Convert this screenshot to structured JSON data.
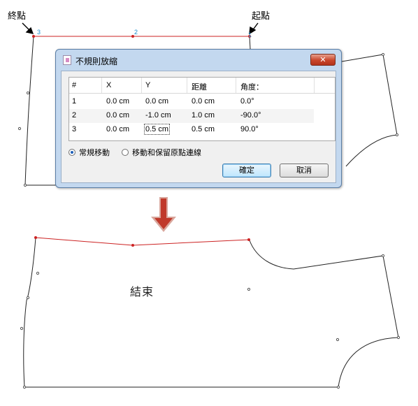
{
  "annotations": {
    "end_point": "終點",
    "start_point": "起點",
    "result": "結束"
  },
  "point_numbers": [
    "3",
    "2",
    "1"
  ],
  "dialog": {
    "title": "不規則放縮",
    "close_symbol": "✕",
    "columns": [
      "#",
      "X",
      "Y",
      "距離",
      "角度："
    ],
    "rows": [
      {
        "num": "1",
        "x": "0.0 cm",
        "y": "0.0 cm",
        "dist": "0.0 cm",
        "angle": "0.0°"
      },
      {
        "num": "2",
        "x": "0.0 cm",
        "y": "-1.0 cm",
        "dist": "1.0 cm",
        "angle": "-90.0°"
      },
      {
        "num": "3",
        "x": "0.0 cm",
        "y": "0.5 cm",
        "dist": "0.5 cm",
        "angle": "90.0°"
      }
    ],
    "options": [
      {
        "label": "常規移動",
        "selected": true
      },
      {
        "label": "移動和保留原點連線",
        "selected": false
      }
    ],
    "ok_label": "確定",
    "cancel_label": "取消"
  },
  "colors": {
    "edit_line": "#cc2222",
    "arrow_fill": "#c0392b",
    "point_label": "#1a8fd0"
  }
}
